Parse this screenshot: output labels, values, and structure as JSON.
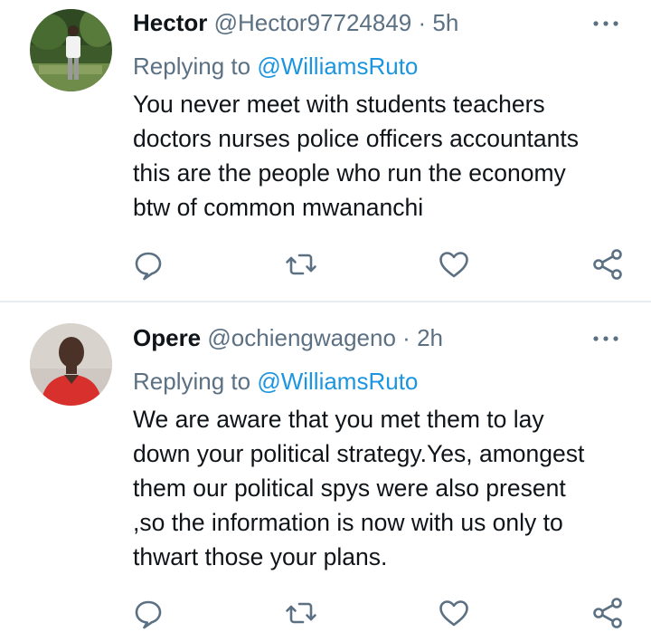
{
  "tweets": [
    {
      "display_name": "Hector",
      "handle": "@Hector97724849",
      "separator": "·",
      "time": "5h",
      "replying_prefix": "Replying to",
      "replying_to": "@WilliamsRuto",
      "body_lines": [
        "You never meet with students teachers",
        "doctors nurses police officers accountants",
        "this are the people who run the economy",
        "btw of common mwananchi"
      ],
      "avatar": "photo-man-standing-outdoors"
    },
    {
      "display_name": "Opere",
      "handle": "@ochiengwageno",
      "separator": "·",
      "time": "2h",
      "replying_prefix": "Replying to",
      "replying_to": "@WilliamsRuto",
      "body_lines": [
        "We are aware that you met them to lay",
        "down your political strategy.Yes, amongest",
        "them our political spys were also present",
        ",so the information is now with us only to",
        "thwart those your plans."
      ],
      "avatar": "photo-person-red-shirt"
    }
  ],
  "action_icons": [
    "reply-icon",
    "retweet-icon",
    "like-icon",
    "share-icon"
  ],
  "colors": {
    "text": "#0f1419",
    "secondary": "#5b7083",
    "link": "#1b95e0",
    "divider": "#e6ecf0"
  }
}
